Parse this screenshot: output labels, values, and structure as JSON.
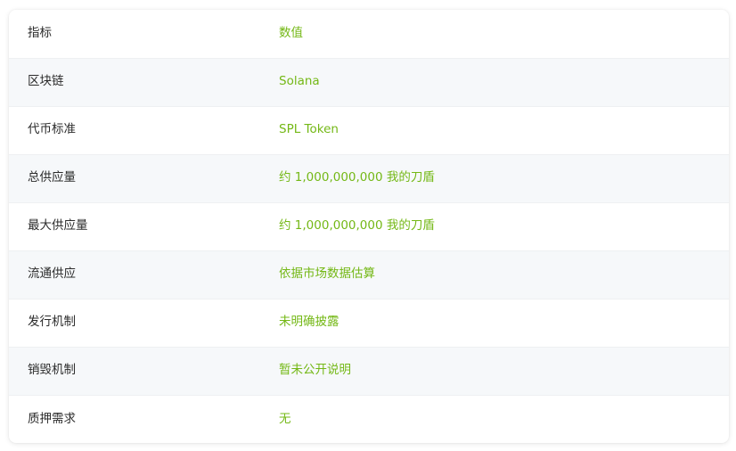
{
  "table": {
    "rows": [
      {
        "label": "指标",
        "value": "数值"
      },
      {
        "label": "区块链",
        "value": "Solana"
      },
      {
        "label": "代币标准",
        "value": "SPL Token"
      },
      {
        "label": "总供应量",
        "value": "约 1,000,000,000 我的刀盾"
      },
      {
        "label": "最大供应量",
        "value": "约 1,000,000,000 我的刀盾"
      },
      {
        "label": "流通供应",
        "value": "依据市场数据估算"
      },
      {
        "label": "发行机制",
        "value": "未明确披露"
      },
      {
        "label": "销毁机制",
        "value": "暂未公开说明"
      },
      {
        "label": "质押需求",
        "value": "无"
      }
    ]
  },
  "colors": {
    "label_text": "#2b2b2b",
    "value_text": "#74b816",
    "alt_row_bg": "#f6f8fa"
  }
}
